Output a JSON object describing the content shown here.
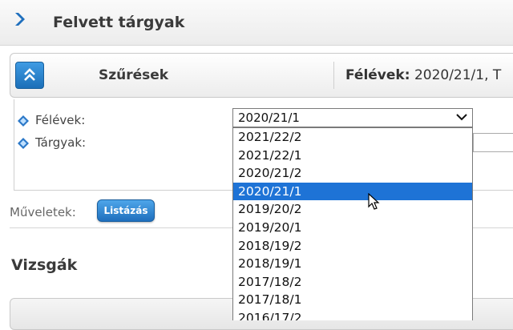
{
  "header": {
    "title": "Felvett tárgyak",
    "icon": "chevron-right-icon"
  },
  "filter_bar": {
    "title": "Szűrések",
    "summary_label": "Félévek:",
    "summary_value": "2020/21/1, T",
    "collapse_icon": "double-chevron-up-icon"
  },
  "filters": {
    "semesters_label": "Félévek:",
    "subjects_label": "Tárgyak:",
    "selected_semester": "2020/21/1",
    "options": [
      "2021/22/2",
      "2021/22/1",
      "2020/21/2",
      "2020/21/1",
      "2019/20/2",
      "2019/20/1",
      "2018/19/2",
      "2018/19/1",
      "2017/18/2",
      "2017/18/1",
      "2016/17/2"
    ],
    "highlighted_option": "2020/21/1"
  },
  "actions": {
    "label": "Műveletek:",
    "list_button": "Listázás"
  },
  "exams": {
    "title": "Vizsgák"
  },
  "colors": {
    "accent": "#1e73d6",
    "button": "#2f86d3"
  }
}
